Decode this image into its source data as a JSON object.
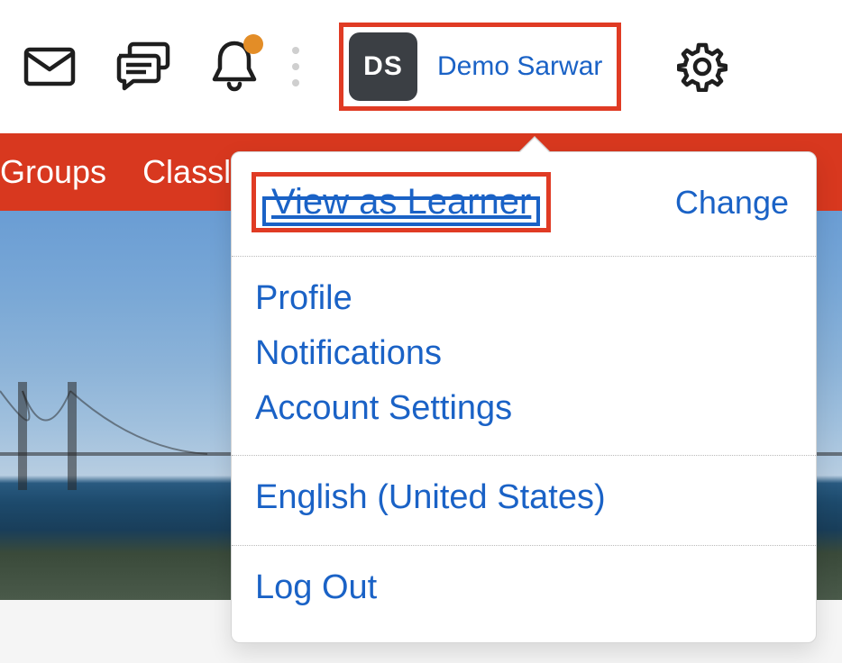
{
  "topbar": {
    "user": {
      "initials": "DS",
      "name": "Demo Sarwar"
    }
  },
  "navbar": {
    "items": [
      "Groups",
      "Classli"
    ]
  },
  "dropdown": {
    "view_as": "View as Learner",
    "change": "Change",
    "links": {
      "profile": "Profile",
      "notifications": "Notifications",
      "account_settings": "Account Settings",
      "language": "English (United States)",
      "log_out": "Log Out"
    }
  }
}
